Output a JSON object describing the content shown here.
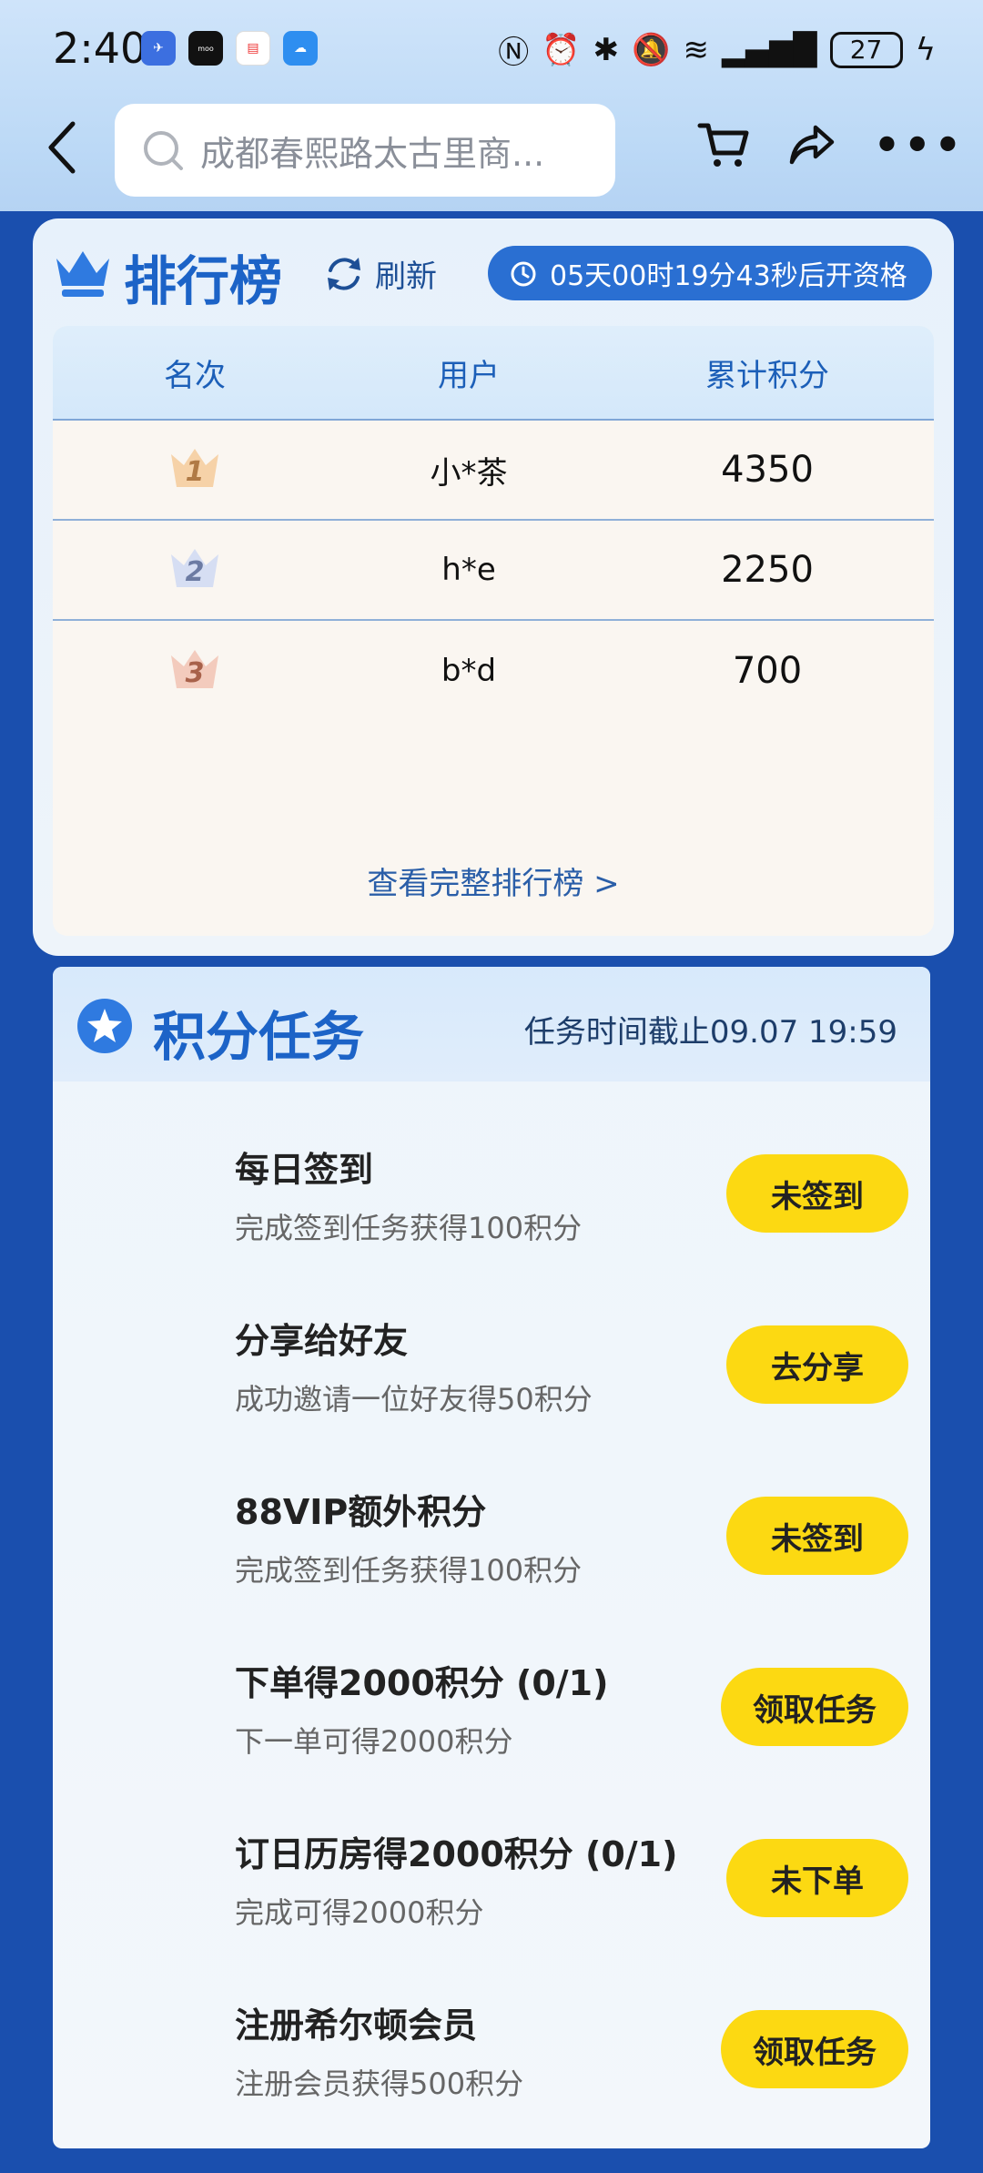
{
  "status_bar": {
    "time": "2:40",
    "battery": "27"
  },
  "navbar": {
    "search_placeholder": "成都春熙路太古里商..."
  },
  "ranking": {
    "title": "排行榜",
    "refresh_label": "刷新",
    "countdown": "05天00时19分43秒后开资格",
    "headers": [
      "名次",
      "用户",
      "累计积分"
    ],
    "rows": [
      {
        "rank": "1",
        "user": "小*茶",
        "points": "4350"
      },
      {
        "rank": "2",
        "user": "h*e",
        "points": "2250"
      },
      {
        "rank": "3",
        "user": "b*d",
        "points": "700"
      }
    ],
    "view_full": "查看完整排行榜 >"
  },
  "tasks": {
    "title": "积分任务",
    "deadline": "任务时间截止09.07 19:59",
    "items": [
      {
        "name": "每日签到",
        "desc": "完成签到任务获得100积分",
        "button": "未签到"
      },
      {
        "name": "分享给好友",
        "desc": "成功邀请一位好友得50积分",
        "button": "去分享"
      },
      {
        "name": "88VIP额外积分",
        "desc": "完成签到任务获得100积分",
        "button": "未签到"
      },
      {
        "name": "下单得2000积分 (0/1)",
        "desc": "下一单可得2000积分",
        "button": "领取任务"
      },
      {
        "name": "订日历房得2000积分 (0/1)",
        "desc": "完成可得2000积分",
        "button": "未下单"
      },
      {
        "name": "注册希尔顿会员",
        "desc": "注册会员获得500积分",
        "button": "领取任务"
      }
    ]
  },
  "colors": {
    "accent_blue": "#1c63c7",
    "button_yellow": "#fcd912",
    "background_blue": "#1a4fae"
  }
}
